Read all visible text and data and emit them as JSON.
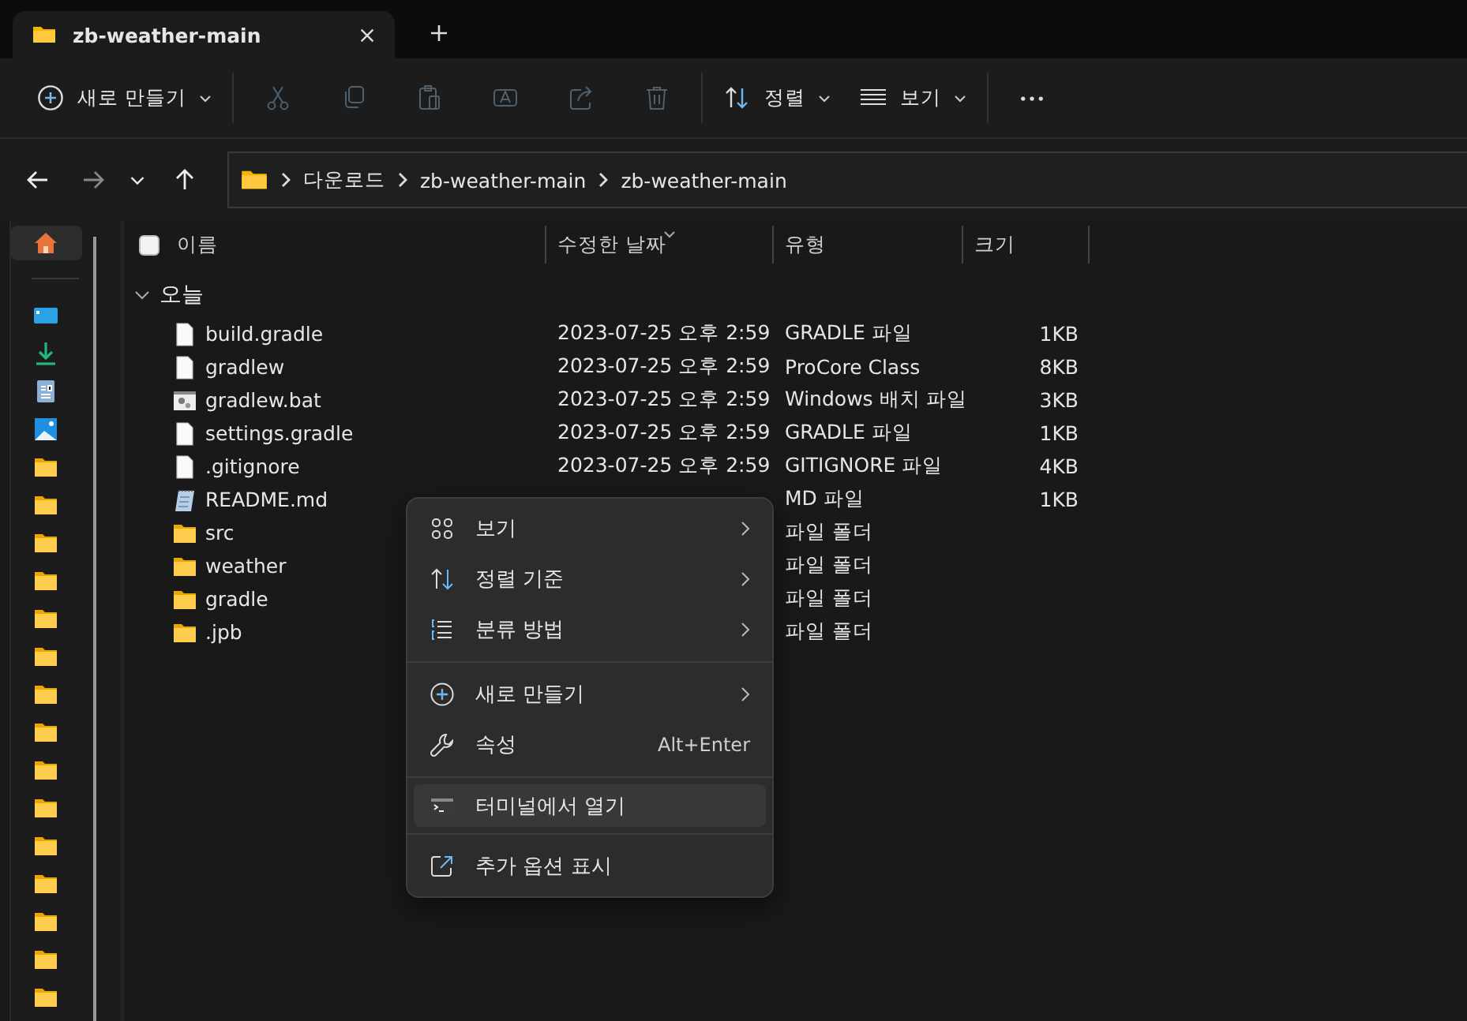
{
  "tabs": [
    {
      "title": "zb-weather-main",
      "selected": true
    }
  ],
  "toolbar": {
    "items": [
      {
        "kind": "new",
        "label": "새로 만들기",
        "disabled": false
      },
      {
        "kind": "cut",
        "disabled": true
      },
      {
        "kind": "copy",
        "disabled": true
      },
      {
        "kind": "paste",
        "disabled": true
      },
      {
        "kind": "rename",
        "disabled": true
      },
      {
        "kind": "share",
        "disabled": true
      },
      {
        "kind": "delete",
        "disabled": true
      },
      {
        "kind": "sort",
        "label": "정렬",
        "disabled": false
      },
      {
        "kind": "view",
        "label": "보기",
        "disabled": false
      },
      {
        "kind": "more",
        "disabled": false
      }
    ]
  },
  "address": {
    "path": [
      "다운로드",
      "zb-weather-main",
      "zb-weather-main"
    ]
  },
  "sidebar": {
    "items": [
      {
        "kind": "home",
        "selected": true
      },
      {
        "kind": "desktop",
        "selected": false
      },
      {
        "kind": "downloads",
        "selected": false
      },
      {
        "kind": "documents",
        "selected": false
      },
      {
        "kind": "pictures",
        "selected": false
      },
      {
        "kind": "folder",
        "selected": false
      },
      {
        "kind": "folder",
        "selected": false
      },
      {
        "kind": "folder",
        "selected": false
      },
      {
        "kind": "folder",
        "selected": false
      },
      {
        "kind": "folder",
        "selected": false
      },
      {
        "kind": "folder",
        "selected": false
      },
      {
        "kind": "folder",
        "selected": false
      },
      {
        "kind": "folder",
        "selected": false
      },
      {
        "kind": "folder",
        "selected": false
      },
      {
        "kind": "folder",
        "selected": false
      },
      {
        "kind": "folder",
        "selected": false
      },
      {
        "kind": "folder",
        "selected": false
      },
      {
        "kind": "folder",
        "selected": false
      },
      {
        "kind": "folder",
        "selected": false
      },
      {
        "kind": "folder",
        "selected": false
      }
    ]
  },
  "table": {
    "columns": [
      "이름",
      "수정한 날짜",
      "유형",
      "크기"
    ],
    "select_all": {
      "checked": false
    },
    "group": {
      "label": "오늘",
      "expanded": true
    },
    "rows": [
      {
        "kind": "file",
        "name": "build.gradle",
        "date": "2023-07-25 오후 2:59",
        "type": "GRADLE 파일",
        "size": "1KB"
      },
      {
        "kind": "file",
        "name": "gradlew",
        "date": "2023-07-25 오후 2:59",
        "type": "ProCore Class",
        "size": "8KB"
      },
      {
        "kind": "batch",
        "name": "gradlew.bat",
        "date": "2023-07-25 오후 2:59",
        "type": "Windows 배치 파일",
        "size": "3KB"
      },
      {
        "kind": "file",
        "name": "settings.gradle",
        "date": "2023-07-25 오후 2:59",
        "type": "GRADLE 파일",
        "size": "1KB"
      },
      {
        "kind": "file",
        "name": ".gitignore",
        "date": "2023-07-25 오후 2:59",
        "type": "GITIGNORE 파일",
        "size": "4KB"
      },
      {
        "kind": "text",
        "name": "README.md",
        "type": "MD 파일",
        "size": "1KB"
      },
      {
        "kind": "folder",
        "name": "src",
        "type": "파일 폴더"
      },
      {
        "kind": "folder",
        "name": "weather",
        "type": "파일 폴더"
      },
      {
        "kind": "folder",
        "name": "gradle",
        "type": "파일 폴더"
      },
      {
        "kind": "folder",
        "name": ".jpb",
        "type": "파일 폴더"
      }
    ]
  },
  "context_menu": {
    "items": [
      {
        "kind": "view",
        "label": "보기",
        "submenu": true,
        "selected": false
      },
      {
        "kind": "sort",
        "label": "정렬 기준",
        "submenu": true,
        "selected": false
      },
      {
        "kind": "group",
        "label": "분류 방법",
        "submenu": true,
        "selected": false
      },
      {
        "kind": "separator"
      },
      {
        "kind": "new",
        "label": "새로 만들기",
        "submenu": true,
        "selected": false
      },
      {
        "kind": "properties",
        "label": "속성",
        "shortcut": "Alt+Enter",
        "submenu": false,
        "selected": false
      },
      {
        "kind": "separator"
      },
      {
        "kind": "terminal",
        "label": "터미널에서 열기",
        "submenu": false,
        "selected": true
      },
      {
        "kind": "separator"
      },
      {
        "kind": "more",
        "label": "추가 옵션 표시",
        "submenu": false,
        "selected": false
      }
    ]
  }
}
